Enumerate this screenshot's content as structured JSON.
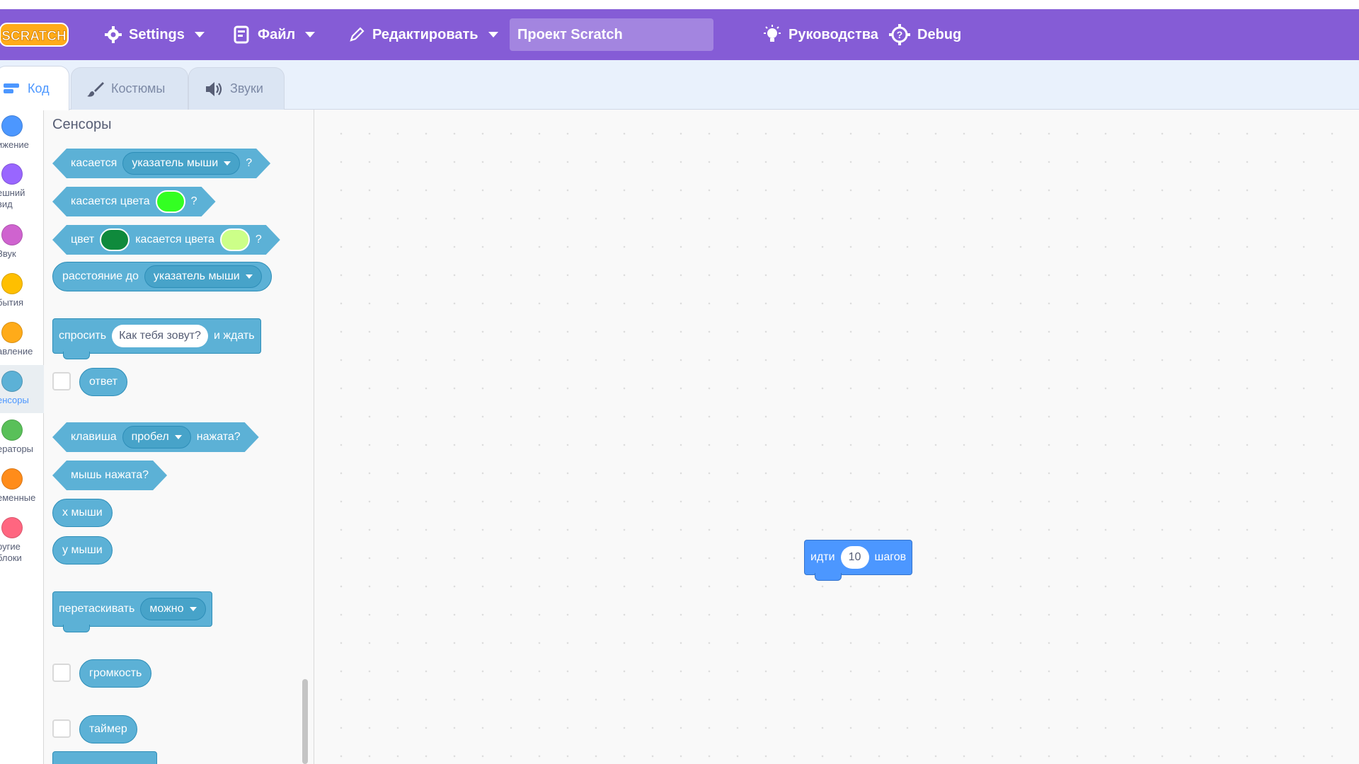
{
  "menubar": {
    "logo_text": "SCRATCH",
    "settings_label": "Settings",
    "file_label": "Файл",
    "edit_label": "Редактировать",
    "project_title": "Проект Scratch",
    "tutorials_label": "Руководства",
    "debug_label": "Debug",
    "bg_color": "#855cd6"
  },
  "tabs": [
    {
      "label": "Код",
      "icon": "code-icon",
      "active": true
    },
    {
      "label": "Костюмы",
      "icon": "brush-icon",
      "active": false
    },
    {
      "label": "Звуки",
      "icon": "speaker-icon",
      "active": false
    }
  ],
  "categories": [
    {
      "label": "ижение",
      "color": "#4c97ff"
    },
    {
      "label": "ешний\nвид",
      "color": "#9966ff"
    },
    {
      "label": "Звук",
      "color": "#cf63cf"
    },
    {
      "label": "бытия",
      "color": "#ffbf00"
    },
    {
      "label": "авление",
      "color": "#ffab19"
    },
    {
      "label": "енсоры",
      "color": "#5cb1d6",
      "active": true
    },
    {
      "label": "ераторы",
      "color": "#59c059"
    },
    {
      "label": "еменные",
      "color": "#ff8c1a"
    },
    {
      "label": "ругие\nблоки",
      "color": "#ff6680"
    }
  ],
  "palette": {
    "title": "Сенсоры",
    "touching": {
      "text": "касается",
      "menu": "указатель мыши",
      "q": "?"
    },
    "touching_color": {
      "text": "касается цвета",
      "color": "#33ff22",
      "q": "?"
    },
    "color_touching": {
      "text1": "цвет",
      "color1": "#0f8a3c",
      "text2": "касается цвета",
      "color2": "#ccff88",
      "q": "?"
    },
    "distance": {
      "text": "расстояние до",
      "menu": "указатель мыши"
    },
    "ask": {
      "text1": "спросить",
      "input": "Как тебя зовут?",
      "text2": "и ждать"
    },
    "answer": "ответ",
    "key_pressed": {
      "text1": "клавиша",
      "menu": "пробел",
      "text2": "нажата?"
    },
    "mouse_down": "мышь нажата?",
    "mouse_x": "х мыши",
    "mouse_y": "у мыши",
    "drag_mode": {
      "text": "перетаскивать",
      "menu": "можно"
    },
    "loudness": "громкость",
    "timer": "таймер",
    "block_color": "#5cb1d6"
  },
  "workspace": {
    "move_block": {
      "text1": "идти",
      "value": "10",
      "text2": "шагов",
      "color": "#4c97ff"
    }
  }
}
